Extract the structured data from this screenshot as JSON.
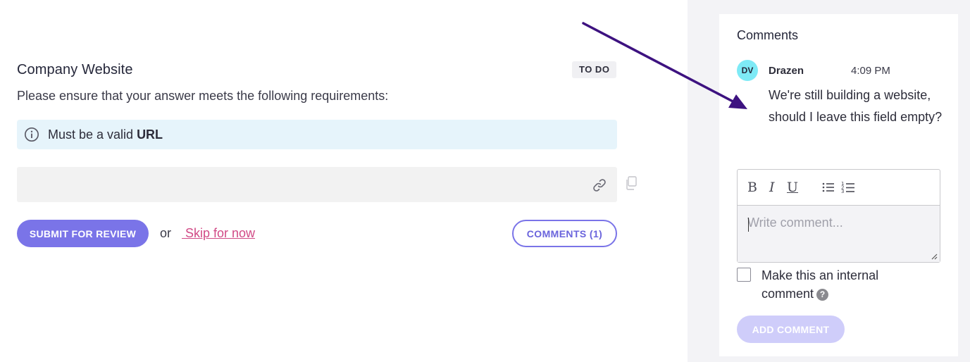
{
  "question": {
    "title": "Company Website",
    "status": "TO DO",
    "description": "Please ensure that your answer meets the following requirements:",
    "requirement_prefix": "Must be a valid ",
    "requirement_bold": "URL",
    "answer_value": ""
  },
  "actions": {
    "submit_label": "SUBMIT FOR REVIEW",
    "or_text": "or",
    "skip_label": " Skip for now",
    "comments_label": "COMMENTS (1)"
  },
  "comments": {
    "title": "Comments",
    "items": [
      {
        "initials": "DV",
        "author": "Drazen",
        "time": "4:09 PM",
        "text": "We're still building a website, should I leave this field empty?"
      }
    ],
    "editor": {
      "toolbar": {
        "bold": "B",
        "italic": "I",
        "underline": "U"
      },
      "placeholder": "Write comment..."
    },
    "internal_label": "Make this an internal comment",
    "help_glyph": "?",
    "add_label": "ADD COMMENT"
  },
  "colors": {
    "primary": "#7a74e8",
    "link": "#d14a86",
    "info_bg": "#e6f4fb",
    "avatar_bg": "#7eeaf6",
    "annotation_arrow": "#3d1280",
    "disabled_button": "#cfcdfa"
  },
  "icons": {
    "info": "info-circle-icon",
    "link": "link-icon",
    "copy": "copy-icon",
    "bullet_list": "bullet-list-icon",
    "numbered_list": "numbered-list-icon",
    "help": "question-circle-icon"
  }
}
